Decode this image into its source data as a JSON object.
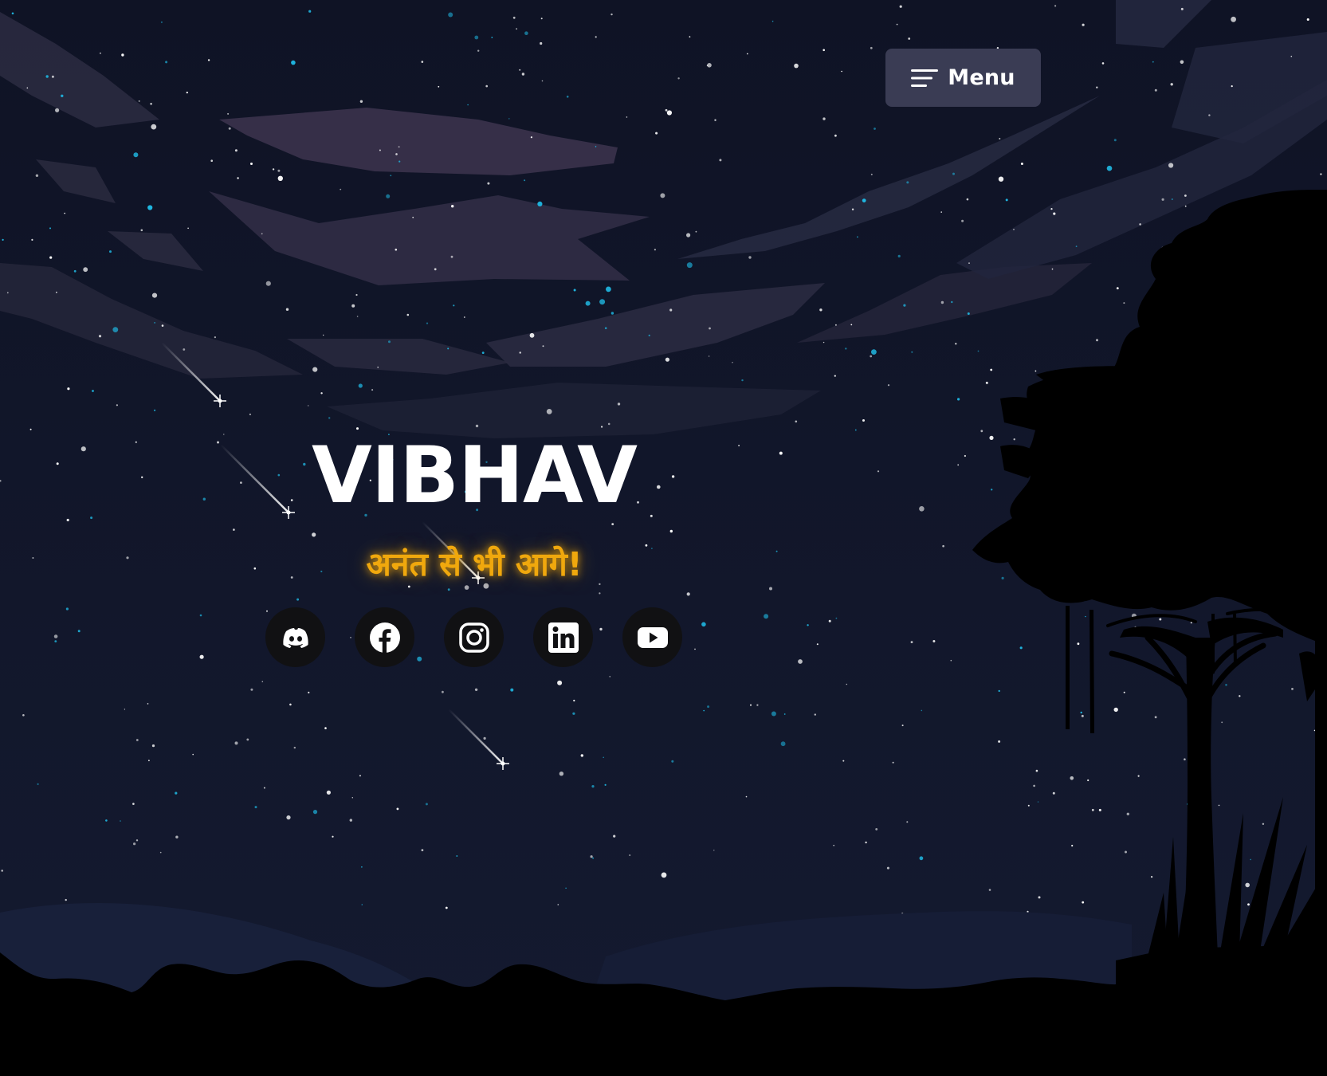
{
  "header": {
    "menu_label": "Menu",
    "menu_icon": "hamburger-icon"
  },
  "hero": {
    "title": "VIBHAV",
    "tagline": "अनंत से भी आगे!",
    "tagline_color": "#f0a80d"
  },
  "social_links": [
    {
      "icon": "discord-icon"
    },
    {
      "icon": "facebook-icon"
    },
    {
      "icon": "instagram-icon"
    },
    {
      "icon": "linkedin-icon"
    },
    {
      "icon": "youtube-icon"
    }
  ],
  "colors": {
    "sky_top": "#0f1325",
    "sky_bottom": "#141a30",
    "menu_background": "#3a3c54",
    "silhouette": "#000000",
    "star_white": "#ffffff",
    "star_cyan": "#1fb6e0"
  }
}
